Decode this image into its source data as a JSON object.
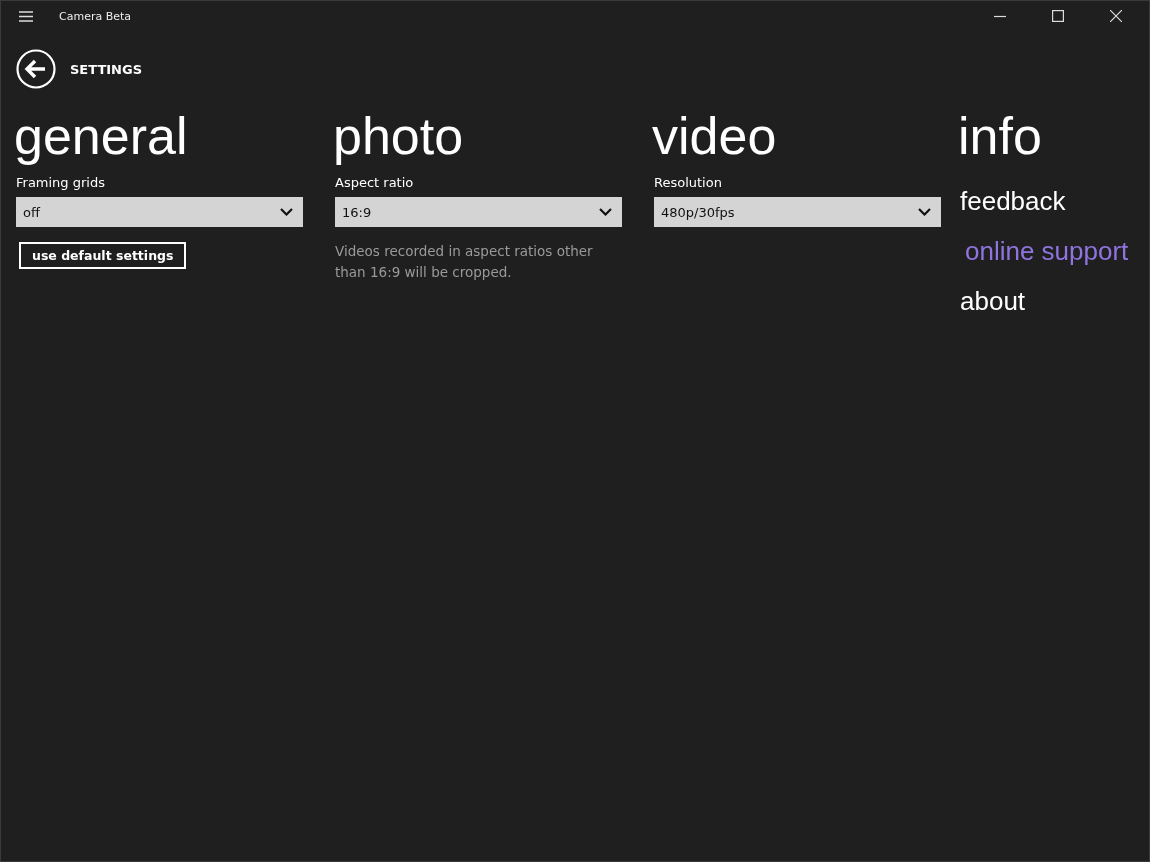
{
  "window": {
    "title": "Camera Beta"
  },
  "page_title": "SETTINGS",
  "sections": [
    {
      "kind": "general",
      "heading": "general",
      "setting": {
        "label": "Framing grids",
        "value": "off"
      },
      "button": "use default settings"
    },
    {
      "kind": "photo",
      "heading": "photo",
      "setting": {
        "label": "Aspect ratio",
        "value": "16:9"
      },
      "note": "Videos recorded in aspect ratios other than 16:9 will be cropped."
    },
    {
      "kind": "video",
      "heading": "video",
      "setting": {
        "label": "Resolution",
        "value": "480p/30fps"
      }
    },
    {
      "kind": "info",
      "heading": "info",
      "links": [
        {
          "label": "feedback",
          "selected": false
        },
        {
          "label": "online support",
          "selected": true
        },
        {
          "label": "about",
          "selected": false
        }
      ]
    }
  ]
}
